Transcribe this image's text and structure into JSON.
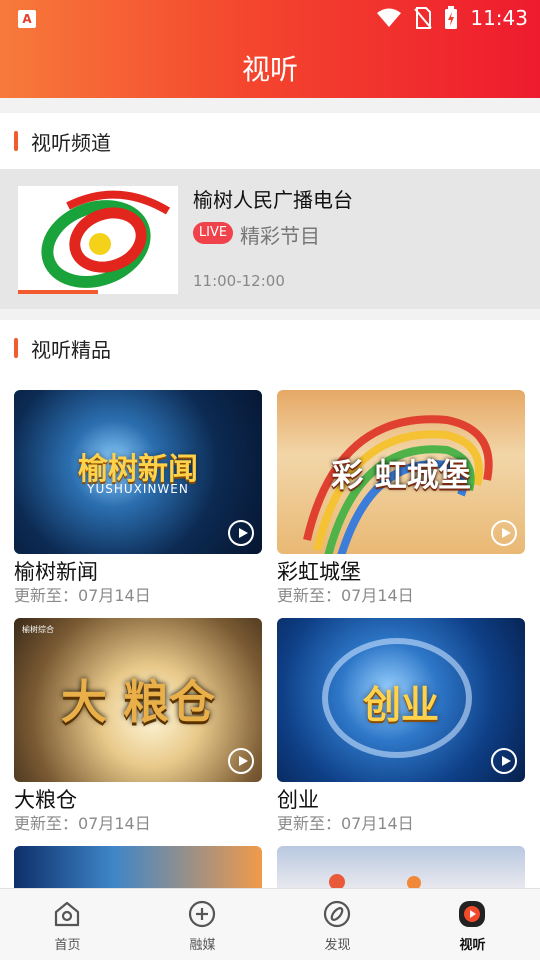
{
  "status_bar": {
    "time": "11:43",
    "app_icon": "A"
  },
  "header": {
    "title": "视听"
  },
  "channels_section": {
    "title": "视听频道"
  },
  "channel": {
    "name": "榆树人民广播电台",
    "badge": "LIVE",
    "program": "精彩节目",
    "time": "11:00-12:00"
  },
  "featured_section": {
    "title": "视听精品"
  },
  "items": [
    {
      "title": "榆树新闻",
      "updated": "更新至：07月14日",
      "thumb_text": "榆树新闻",
      "thumb_sub": "YUSHUXINWEN"
    },
    {
      "title": "彩虹城堡",
      "updated": "更新至：07月14日",
      "thumb_text": "彩 虹城堡"
    },
    {
      "title": "大粮仓",
      "updated": "更新至：07月14日",
      "thumb_text": "大 粮仓",
      "thumb_logo": "榆树综合"
    },
    {
      "title": "创业",
      "updated": "更新至：07月14日",
      "thumb_text": "创业"
    }
  ],
  "tabs": [
    {
      "label": "首页",
      "icon": "home-icon"
    },
    {
      "label": "融媒",
      "icon": "plus-icon"
    },
    {
      "label": "发现",
      "icon": "discover-icon"
    },
    {
      "label": "视听",
      "icon": "play-icon"
    }
  ]
}
